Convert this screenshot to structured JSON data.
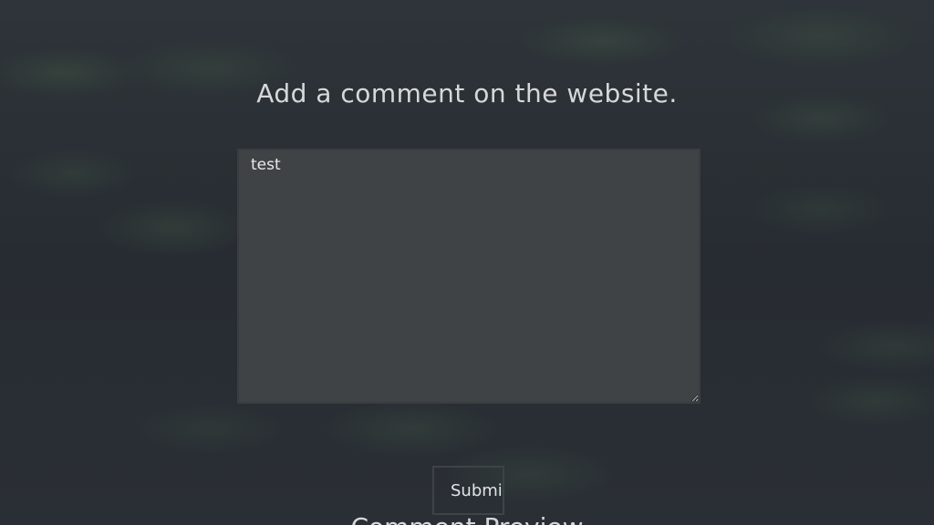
{
  "page": {
    "title": "Add a comment on the website."
  },
  "form": {
    "comment_value": "test",
    "submit_label": "Submit"
  },
  "preview": {
    "heading": "Comment Preview"
  },
  "colors": {
    "background": "#2a2f35",
    "textarea_bg": "#404345",
    "text": "#d6d8da"
  }
}
